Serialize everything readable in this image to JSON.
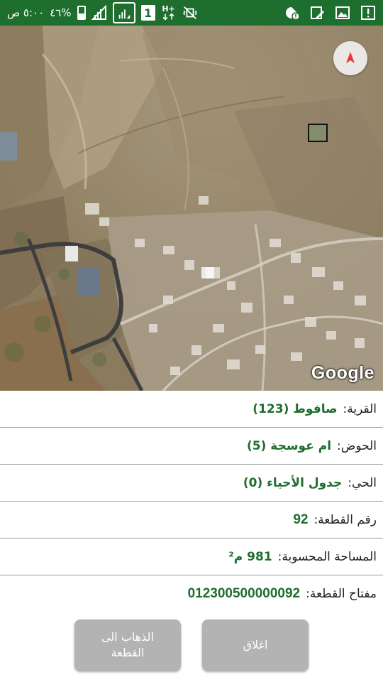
{
  "status_bar": {
    "time": "٥:٠٠ ص",
    "battery_percent": "٤٦%",
    "sim_slot": "1",
    "network_type": "H+",
    "icons": [
      "signal-icon",
      "battery-icon",
      "network-icon",
      "vibrate-icon",
      "alert-icon",
      "image-icon",
      "edit-icon",
      "info-icon"
    ]
  },
  "map": {
    "attribution": "Google",
    "compass_icon": "compass-icon"
  },
  "parcel": {
    "village_label": "القرية:",
    "village_value": "صافوط (123)",
    "basin_label": "الحوض:",
    "basin_value": "ام عوسجة (5)",
    "neighborhood_label": "الحي:",
    "neighborhood_value": "جدول الأحياء (0)",
    "plot_number_label": "رقم القطعة:",
    "plot_number_value": "92",
    "area_label": "المساحة المحسوبة:",
    "area_value": "981 م²",
    "plot_key_label": "مفتاح القطعة:",
    "plot_key_value": "012300500000092"
  },
  "buttons": {
    "close_label": "اغلاق",
    "go_to_plot_label_line1": "الذهاب الى",
    "go_to_plot_label_line2": "القطعة"
  },
  "colors": {
    "status_bar_bg": "#1e6e2e",
    "value_text": "#1e6e2e",
    "button_bg": "#b3b3b3"
  }
}
